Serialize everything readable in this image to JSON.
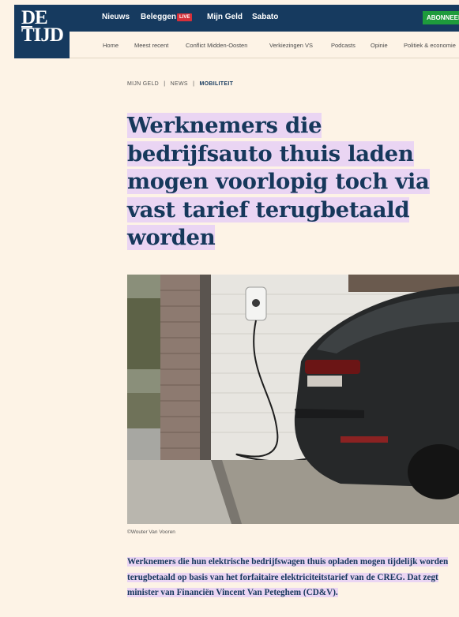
{
  "logo": {
    "line1": "DE",
    "line2": "TIJD"
  },
  "topnav": {
    "items": [
      "Nieuws",
      "Beleggen",
      "Mijn Geld",
      "Sabato"
    ],
    "live_badge": "LIVE",
    "subscribe": "ABONNEER"
  },
  "subnav": {
    "items": [
      "Home",
      "Meest recent",
      "Conflict Midden-Oosten",
      "Verkiezingen VS",
      "Podcasts",
      "Opinie",
      "Politiek & economie"
    ]
  },
  "breadcrumb": {
    "items": [
      "MIJN GELD",
      "NEWS",
      "MOBILITEIT"
    ],
    "separator": "|"
  },
  "article": {
    "headline": "Werknemers die bedrijfsauto thuis laden mogen voorlopig toch via vast tarief terugbetaald worden",
    "photo_credit": "©Wouter Van Vooren",
    "lead": "Werknemers die hun elektrische bedrijfswagen thuis opladen mogen tijdelijk worden terugbetaald op basis van het forfaitaire elektriciteitstarief van de CREG. Dat zegt minister van Financiën Vincent Van Peteghem (CD&V)."
  },
  "colors": {
    "brand_navy": "#163a5f",
    "highlight": "#ead5f3",
    "live_red": "#d6303a",
    "subscribe_green": "#1e9b3c",
    "background": "#fdf3e6"
  }
}
